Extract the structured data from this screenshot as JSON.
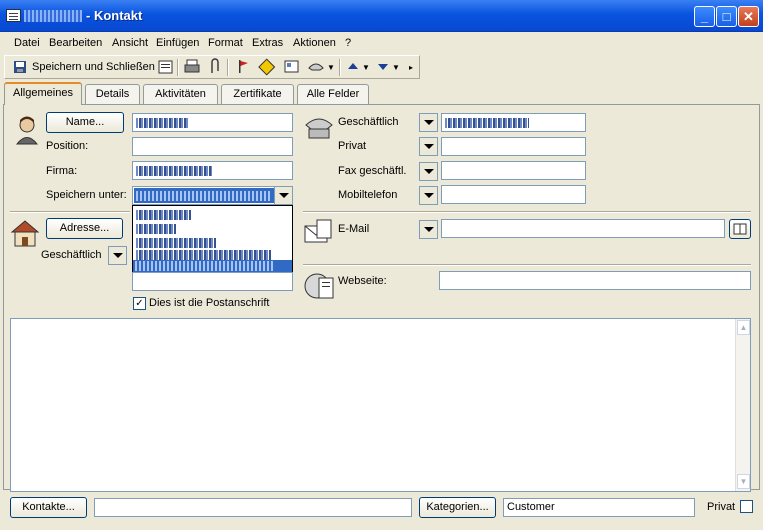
{
  "window": {
    "title": "- Kontakt"
  },
  "menu": [
    "Datei",
    "Bearbeiten",
    "Ansicht",
    "Einfügen",
    "Format",
    "Extras",
    "Aktionen",
    "?"
  ],
  "toolbar": {
    "save_close": "Speichern und Schließen"
  },
  "tabs": [
    "Allgemeines",
    "Details",
    "Aktivitäten",
    "Zertifikate",
    "Alle Felder"
  ],
  "left": {
    "name_button": "Name...",
    "position_label": "Position:",
    "company_label": "Firma:",
    "file_as_label": "Speichern unter:",
    "address_button": "Adresse...",
    "address_type": "Geschäftlich",
    "mailing_address_label": "Dies ist die Postanschrift",
    "mailing_address_checked": true
  },
  "phones": [
    {
      "label": "Geschäftlich"
    },
    {
      "label": "Privat"
    },
    {
      "label": "Fax geschäftl."
    },
    {
      "label": "Mobiltelefon"
    }
  ],
  "email": {
    "label": "E-Mail"
  },
  "web": {
    "label": "Webseite:"
  },
  "footer": {
    "contacts_button": "Kontakte...",
    "categories_button": "Kategorien...",
    "categories_value": "Customer",
    "private_label": "Privat"
  },
  "colors": {
    "titlebar": "#0a54e0",
    "window_bg": "#ece9d8",
    "selection": "#316ac5"
  }
}
